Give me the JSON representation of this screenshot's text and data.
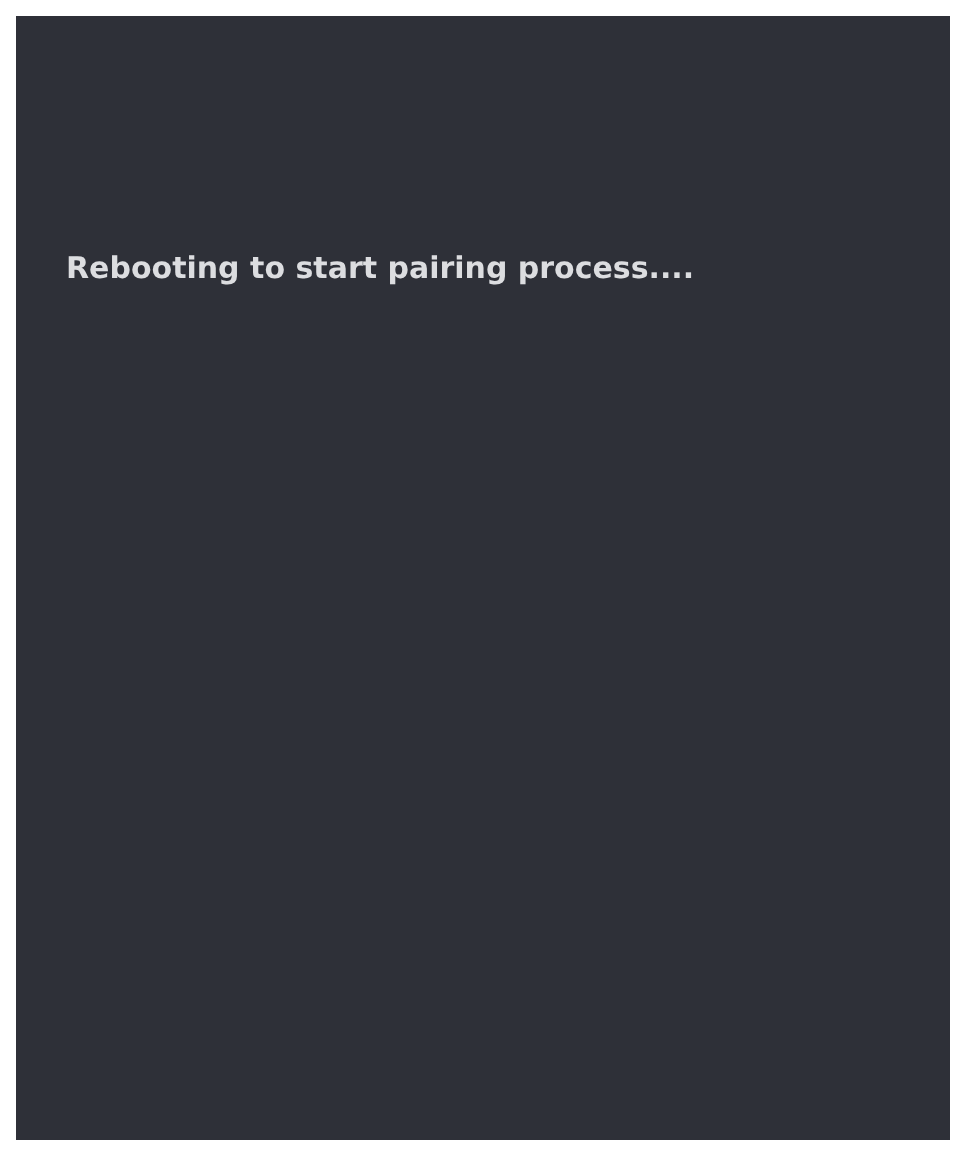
{
  "message": "Rebooting to start pairing process...."
}
